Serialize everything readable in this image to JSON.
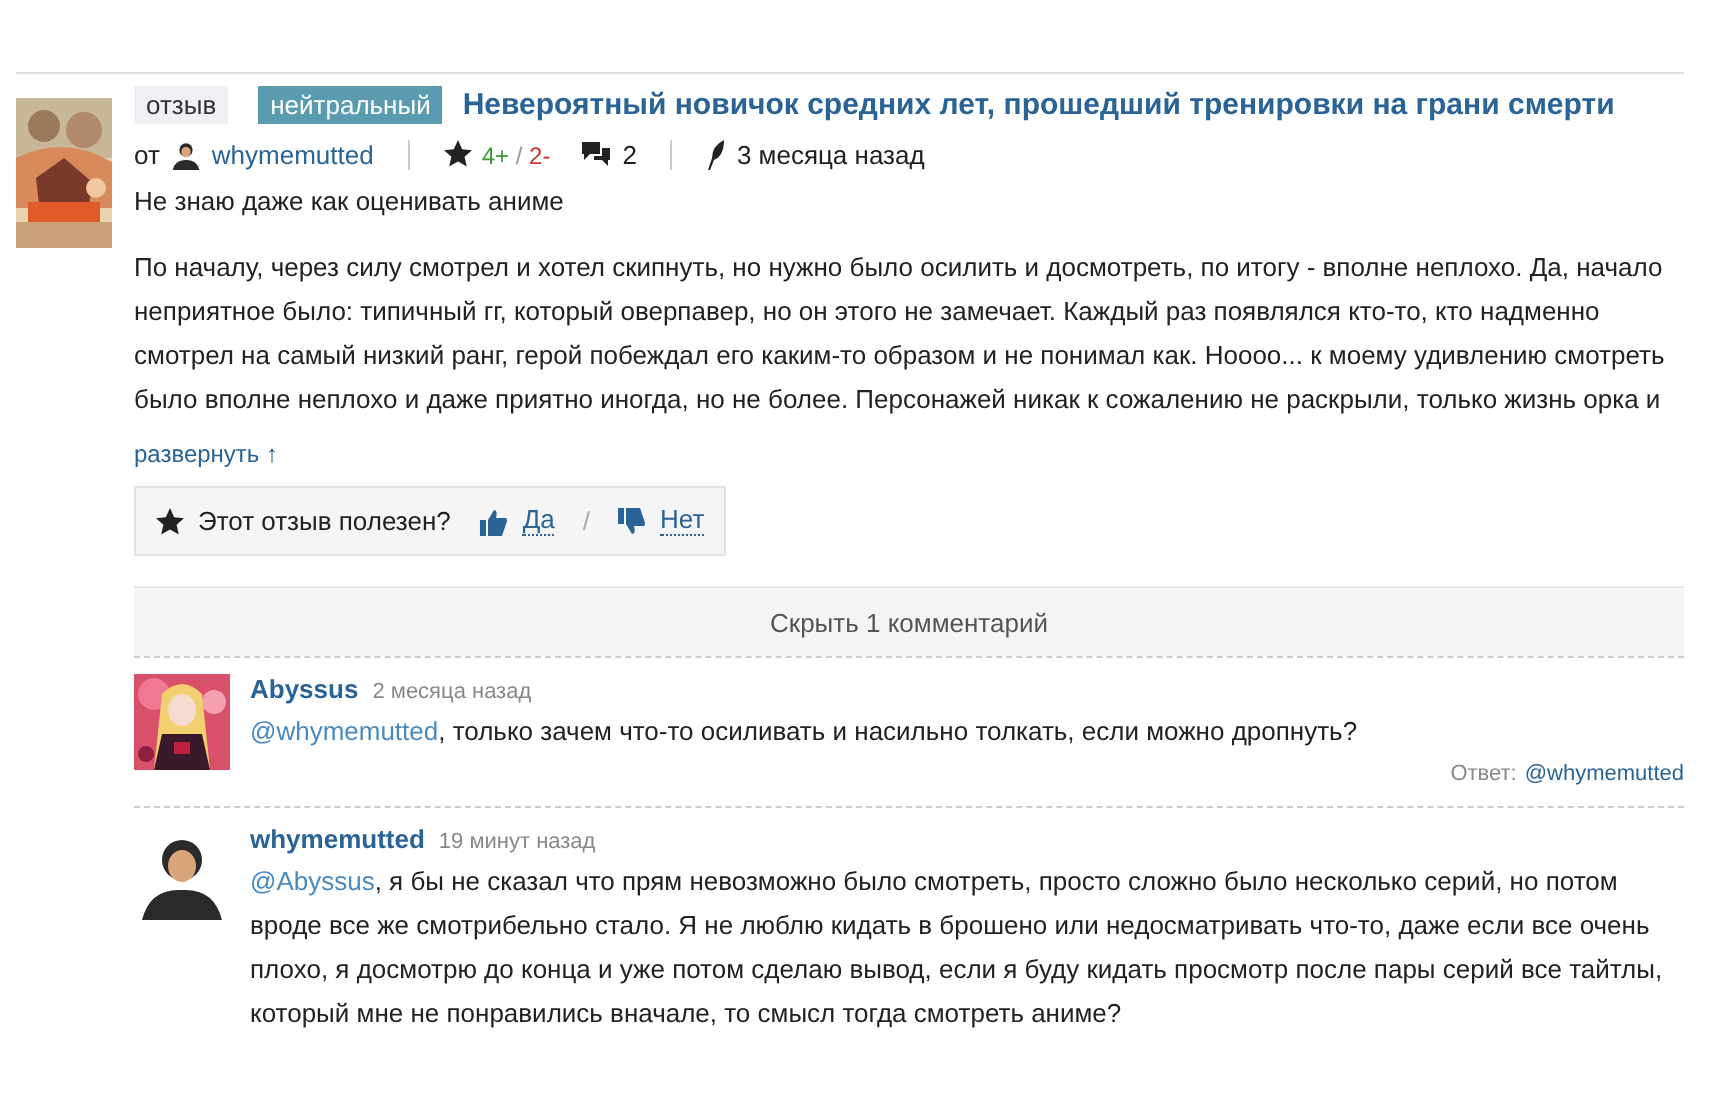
{
  "review": {
    "badge_type": "отзыв",
    "badge_tone": "нейтральный",
    "title": "Невероятный новичок средних лет, прошедший тренировки на грани смерти",
    "author_prefix": "от",
    "author": "whymemutted",
    "rating_plus": "4+",
    "rating_separator": "/",
    "rating_minus": "2-",
    "comments_count": "2",
    "time": "3 месяца назад",
    "summary": "Не знаю даже как оценивать аниме",
    "body": "По началу, через силу смотрел и хотел скипнуть, но нужно было осилить и досмотреть, по итогу - вполне неплохо. Да, начало неприятное было: типичный гг, который оверпавер, но он этого не замечает. Каждый раз появлялся кто-то, кто надменно смотрел на самый низкий ранг, герой побеждал его каким-то образом и не понимал как. Ноооо... к моему удивлению смотреть было вполне неплохо и даже приятно иногда, но не более. Персонажей никак к сожалению не раскрыли, только жизнь орка и",
    "expand_link": "развернуть ↑",
    "helpful": {
      "question": "Этот отзыв полезен?",
      "yes": "Да",
      "separator": "/",
      "no": "Нет"
    }
  },
  "comments_toggle": "Скрыть 1 комментарий",
  "comments": [
    {
      "kind": "picture",
      "author": "Abyssus",
      "time": "2 месяца назад",
      "mention": "@whymemutted",
      "text": ", только зачем что-то осиливать и насильно толкать, если можно дропнуть?",
      "reply_label": "Ответ:",
      "reply_to": "@whymemutted"
    },
    {
      "kind": "silhouette",
      "author": "whymemutted",
      "time": "19 минут назад",
      "mention": "@Abyssus",
      "text": ", я бы не сказал что прям невозможно было смотреть, просто сложно было несколько серий, но потом вроде все же смотрибельно стало. Я не люблю кидать в брошено или недосматривать что-то, даже если все очень плохо, я досмотрю до конца и уже потом сделаю вывод, если я буду кидать просмотр после пары серий все тайтлы, который мне не понравились вначале, то смысл тогда смотреть аниме?"
    }
  ]
}
